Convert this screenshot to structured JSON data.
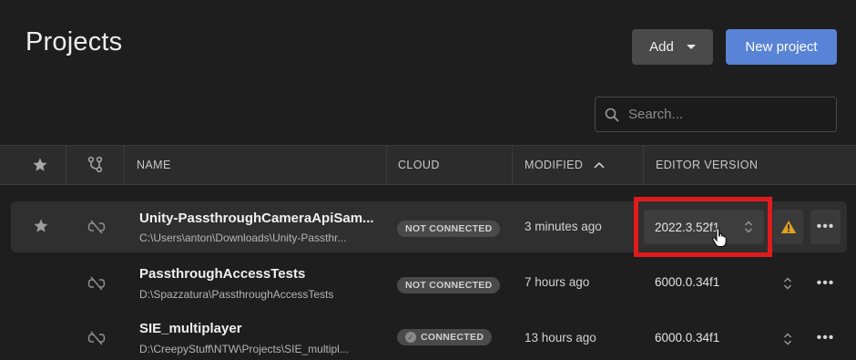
{
  "page": {
    "title": "Projects"
  },
  "toolbar": {
    "add_label": "Add",
    "new_project_label": "New project"
  },
  "search": {
    "placeholder": "Search..."
  },
  "table": {
    "columns": {
      "name": "NAME",
      "cloud": "CLOUD",
      "modified": "MODIFIED",
      "editor_version": "EDITOR VERSION"
    },
    "sort": {
      "column": "modified",
      "direction": "ascending"
    },
    "rows": [
      {
        "name": "Unity-PassthroughCameraApiSam...",
        "path": "C:\\Users\\anton\\Downloads\\Unity-Passthr...",
        "cloud": "NOT CONNECTED",
        "modified": "3 minutes ago",
        "editor_version": "2022.3.52f1",
        "starred": true,
        "warning": true
      },
      {
        "name": "PassthroughAccessTests",
        "path": "D:\\Spazzatura\\PassthroughAccessTests",
        "cloud": "NOT CONNECTED",
        "modified": "7 hours ago",
        "editor_version": "6000.0.34f1",
        "starred": false,
        "warning": false
      },
      {
        "name": "SIE_multiplayer",
        "path": "D:\\CreepyStuff\\NTW\\Projects\\SIE_multipl...",
        "cloud": "CONNECTED",
        "modified": "13 hours ago",
        "editor_version": "6000.0.34f1",
        "starred": false,
        "warning": false
      }
    ]
  },
  "colors": {
    "accent": "#5883d6",
    "background": "#1e1e1e",
    "highlight": "#e01b1b",
    "warning": "#e0a020"
  },
  "icons": {
    "star": "star-icon",
    "branch": "branch-icon",
    "unlinked": "unlinked-icon",
    "search": "search-icon",
    "warning": "warning-icon",
    "more": "more-icon",
    "updown": "chevron-updown-icon",
    "cursor": "hand-cursor-icon"
  }
}
